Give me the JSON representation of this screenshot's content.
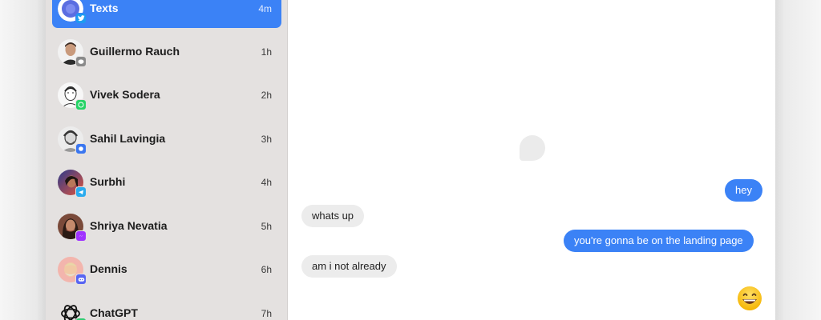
{
  "threads": [
    {
      "name": "Texts",
      "time": "4m",
      "avatar": "texts-app-icon",
      "badge": "twitter-icon",
      "badge_color": "#1d9bf0",
      "selected": true
    },
    {
      "name": "Guillermo Rauch",
      "time": "1h",
      "avatar": "person-avatar",
      "badge": "imessage-icon",
      "badge_color": "#8a8a8a"
    },
    {
      "name": "Vivek Sodera",
      "time": "2h",
      "avatar": "person-avatar",
      "badge": "whatsapp-icon",
      "badge_color": "#25d366"
    },
    {
      "name": "Sahil Lavingia",
      "time": "3h",
      "avatar": "person-avatar",
      "badge": "signal-icon",
      "badge_color": "#3a76f0"
    },
    {
      "name": "Surbhi",
      "time": "4h",
      "avatar": "person-avatar",
      "badge": "telegram-icon",
      "badge_color": "#2aabee"
    },
    {
      "name": "Shriya Nevatia",
      "time": "5h",
      "avatar": "person-avatar",
      "badge": "messenger-icon",
      "badge_color": "#a033ff"
    },
    {
      "name": "Dennis",
      "time": "6h",
      "avatar": "person-avatar",
      "badge": "discord-icon",
      "badge_color": "#5865f2"
    },
    {
      "name": "ChatGPT",
      "time": "7h",
      "avatar": "openai-logo-icon",
      "badge": "imessage-icon",
      "badge_color": "#2ecc71"
    }
  ],
  "messages": [
    {
      "text": "hey",
      "direction": "outgoing"
    },
    {
      "text": "whats up",
      "direction": "incoming"
    },
    {
      "text": "you're gonna be on the landing page",
      "direction": "outgoing"
    },
    {
      "text": "am i not already",
      "direction": "incoming"
    },
    {
      "text": "😄",
      "direction": "outgoing",
      "kind": "emoji"
    }
  ],
  "colors": {
    "accent": "#3b82f6",
    "sidebar_bg": "#e4e1e0",
    "incoming_bubble": "#ececec"
  }
}
